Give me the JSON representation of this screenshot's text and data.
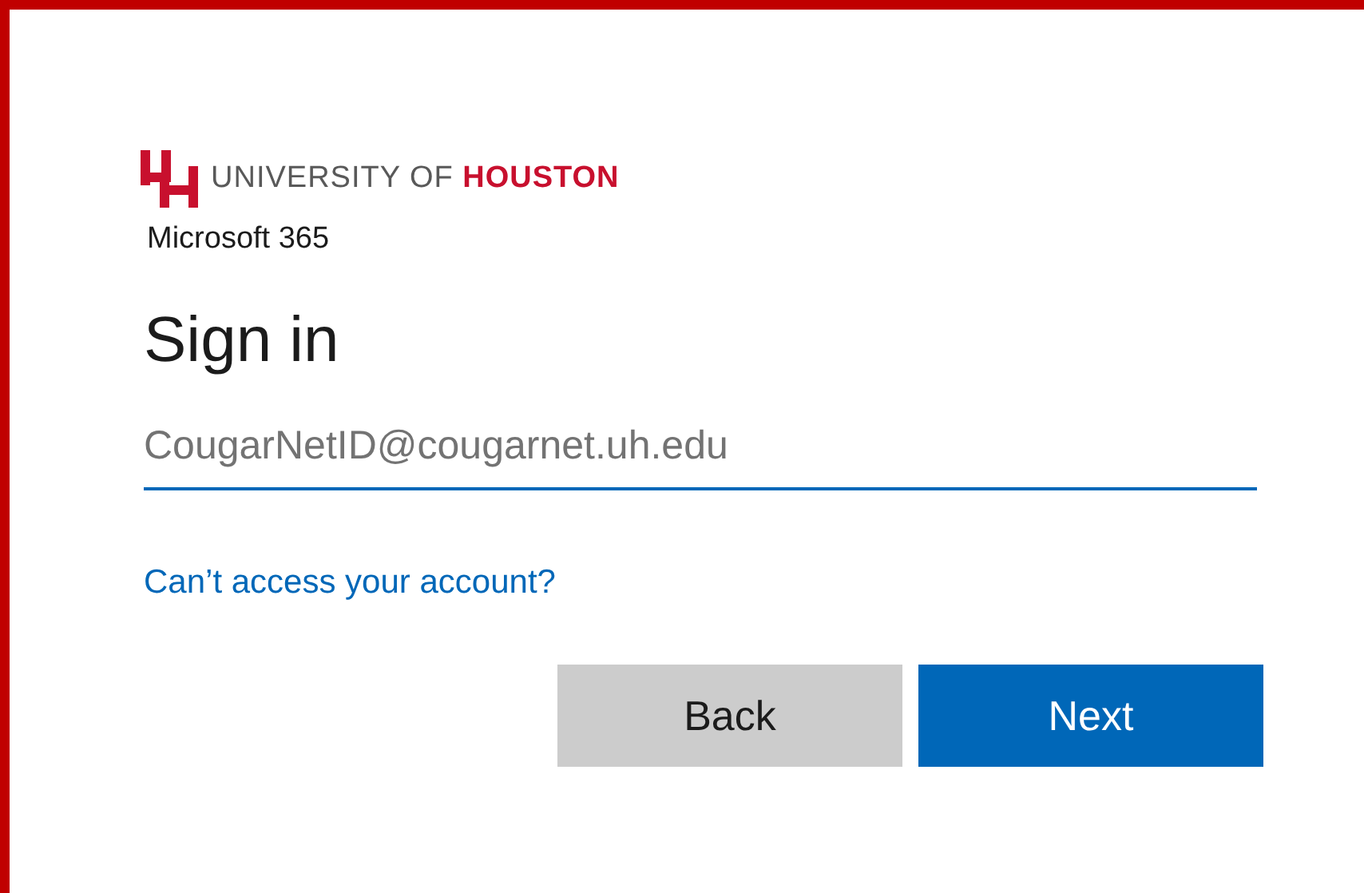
{
  "brand": {
    "wordmark": "UNIVERSITY OF **HOUSTON**",
    "product": "Microsoft 365"
  },
  "title": "Sign in",
  "email_field": {
    "placeholder": "CougarNetID@cougarnet.uh.edu"
  },
  "help_link": "Can’t access your account?",
  "buttons": [
    {
      "label": "Back",
      "kind": "secondary"
    },
    {
      "label": "Next",
      "kind": "primary"
    }
  ]
}
